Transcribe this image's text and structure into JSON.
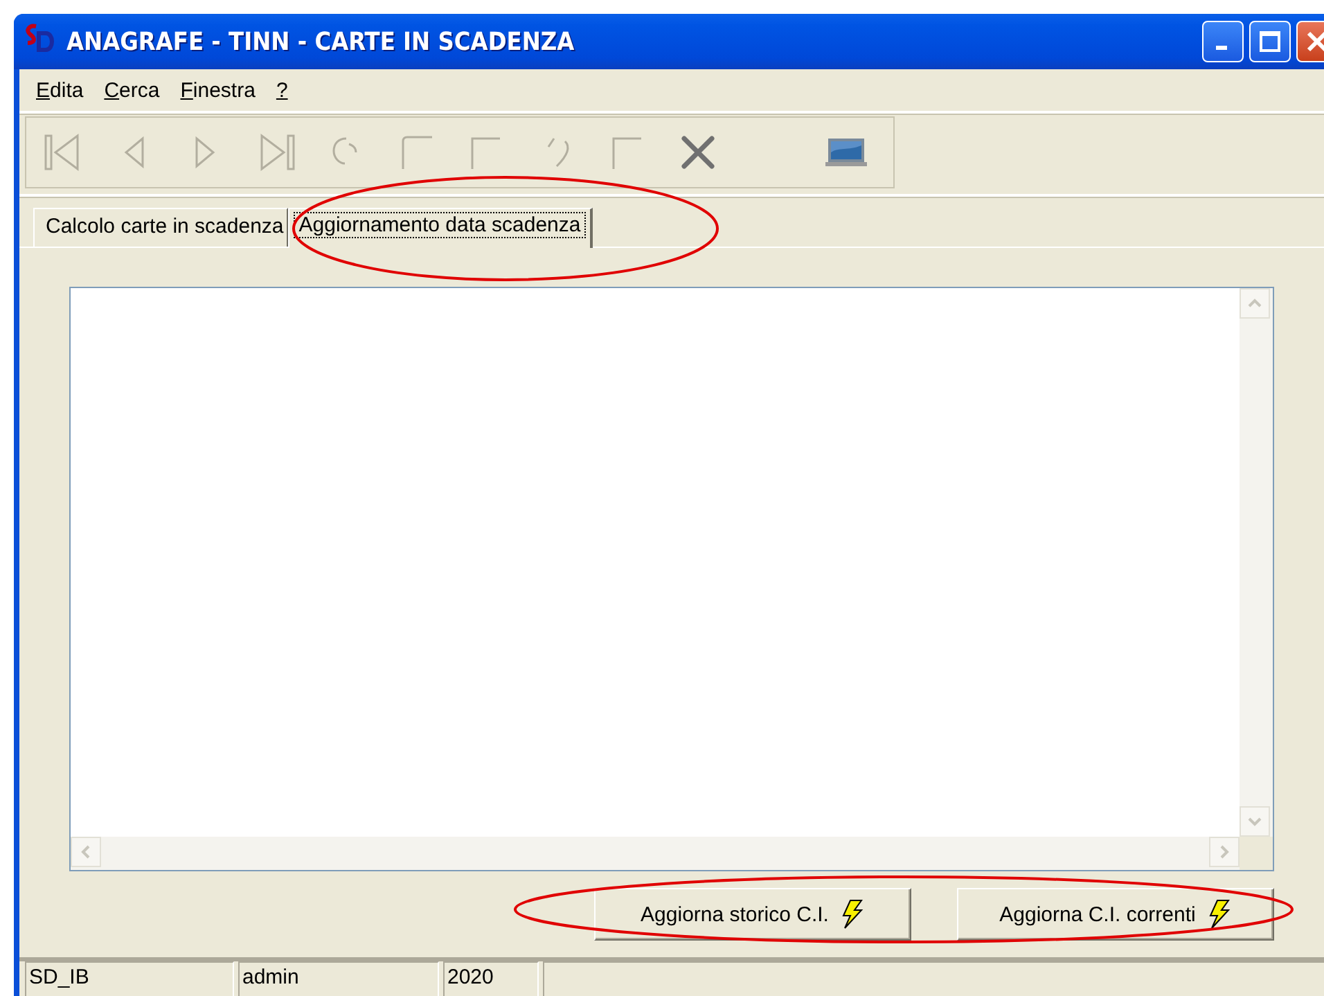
{
  "window": {
    "title": "ANAGRAFE - TINN - CARTE IN SCADENZA"
  },
  "menu": [
    {
      "label": "Edita"
    },
    {
      "label": "Cerca"
    },
    {
      "label": "Finestra"
    },
    {
      "label": "?"
    }
  ],
  "toolbar": [
    {
      "kind": "first",
      "disabled": true
    },
    {
      "kind": "prev",
      "disabled": true
    },
    {
      "kind": "next",
      "disabled": true
    },
    {
      "kind": "last",
      "disabled": true
    },
    {
      "kind": "refresh",
      "disabled": true
    },
    {
      "kind": "new",
      "disabled": true
    },
    {
      "kind": "edit",
      "disabled": true
    },
    {
      "kind": "undo",
      "disabled": true
    },
    {
      "kind": "save",
      "disabled": true
    },
    {
      "kind": "delete",
      "disabled": false
    },
    {
      "kind": "screen",
      "disabled": false
    }
  ],
  "tabs": [
    {
      "label": "Calcolo carte in scadenza",
      "selected": false
    },
    {
      "label": "Aggiornamento data scadenza",
      "selected": true
    }
  ],
  "buttons": [
    {
      "label": "Aggiorna storico C.I."
    },
    {
      "label": "Aggiorna C.I. correnti"
    }
  ],
  "status_bar": [
    {
      "text": "SD_IB"
    },
    {
      "text": "admin"
    },
    {
      "text": "2020"
    }
  ],
  "annotations": [
    {
      "kind": "ellipse"
    },
    {
      "kind": "ellipse"
    }
  ]
}
